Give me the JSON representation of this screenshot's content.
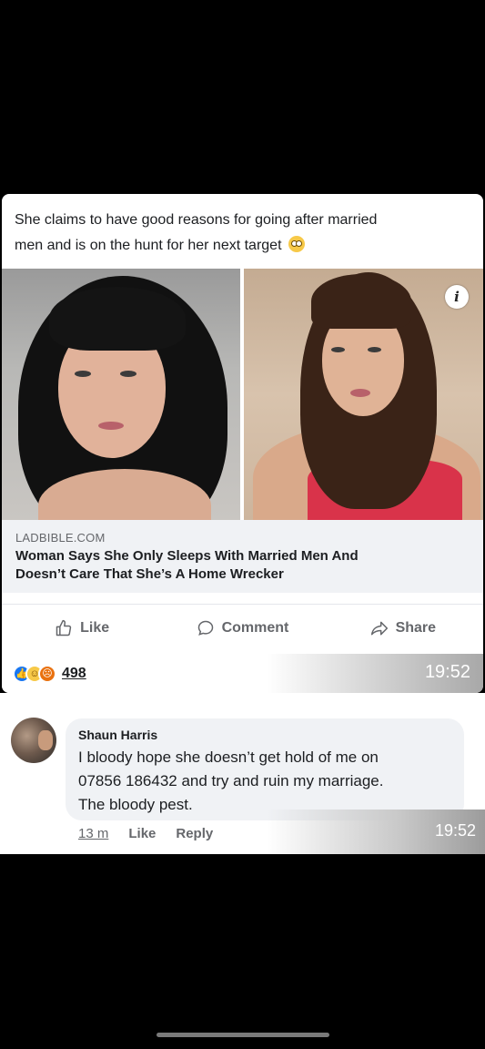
{
  "post": {
    "caption_line1": "She claims to have good reasons for going after married",
    "caption_line2": "men and is on the hunt for her next target",
    "caption_emoji": "flushed-face-emoji",
    "link_domain": "LADBIBLE.COM",
    "link_title_line1": "Woman Says She Only Sleeps With Married Men And",
    "link_title_line2": "Doesn’t Care That She’s A Home Wrecker",
    "info_icon": "i",
    "actions": {
      "like": "Like",
      "comment": "Comment",
      "share": "Share"
    },
    "reactions": [
      "like-icon",
      "haha-icon",
      "angry-icon"
    ],
    "reaction_count": "498",
    "timestamp": "19:52"
  },
  "comment": {
    "author": "Shaun Harris",
    "text": "I bloody hope she doesn’t get hold of me on\n07856 186432 and try and ruin my marriage.\nThe bloody pest.",
    "time": "13 m",
    "like": "Like",
    "reply": "Reply",
    "timestamp": "19:52"
  },
  "colors": {
    "accent": "#1877f2",
    "background": "#000000",
    "bubble": "#f0f2f5",
    "secondary_text": "#65676b"
  }
}
